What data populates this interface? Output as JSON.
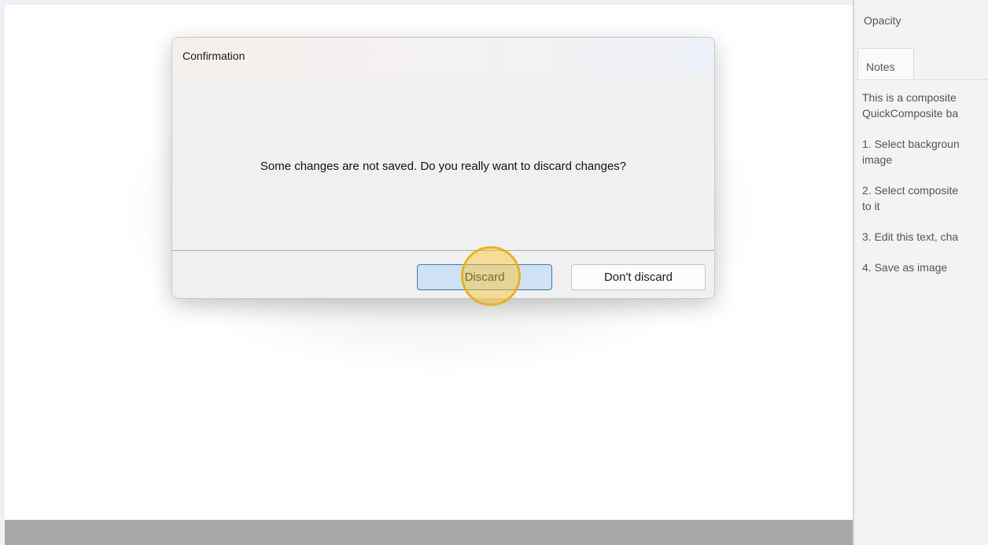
{
  "side_panel": {
    "opacity_label": "Opacity",
    "notes_tab": "Notes",
    "notes_lines": [
      "This is a composite\nQuickComposite ba",
      "1. Select backgroun\nimage",
      "2. Select composite\nto it",
      "3. Edit this text, cha",
      "4. Save as image"
    ]
  },
  "dialog": {
    "title": "Confirmation",
    "message": "Some changes are not saved. Do you really want to discard changes?",
    "discard_label": "Discard",
    "dont_discard_label": "Don't discard"
  },
  "colors": {
    "accent_border": "#3c78b0",
    "discard_fill": "#cfe2f3",
    "click_marker": "#fac428"
  }
}
